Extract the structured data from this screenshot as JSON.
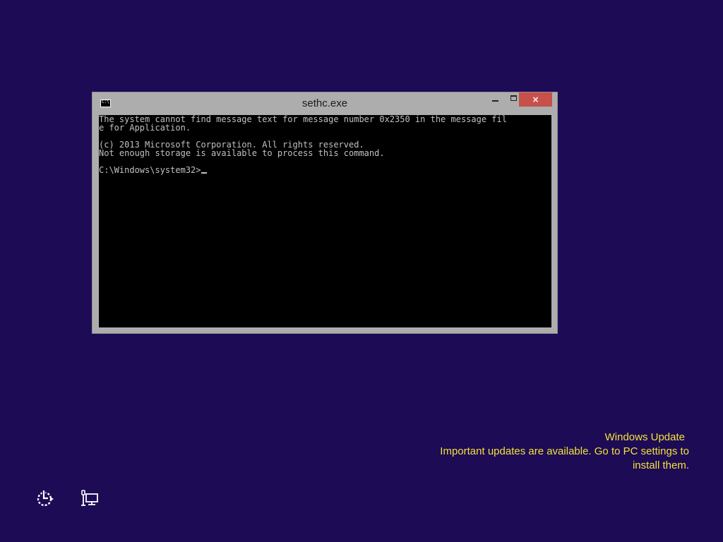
{
  "window": {
    "title": "sethc.exe",
    "close_glyph": "×"
  },
  "console": {
    "output_lines": [
      "The system cannot find message text for message number 0x2350 in the message fil",
      "e for Application.",
      "",
      "(c) 2013 Microsoft Corporation. All rights reserved.",
      "Not enough storage is available to process this command."
    ],
    "prompt": "C:\\Windows\\system32>",
    "app_icon_text": "C:\\"
  },
  "notification": {
    "title": "Windows Update",
    "line1": "Important updates are available. Go to PC settings to",
    "line2": "install them."
  },
  "bottom_bar": {
    "icons": [
      "ease-of-access-icon",
      "network-icon"
    ]
  },
  "colors": {
    "background": "#1d0b55",
    "notification_text": "#f2e13b",
    "close_button": "#c7504a",
    "console_bg": "#000000",
    "console_fg": "#c0c0c0"
  }
}
